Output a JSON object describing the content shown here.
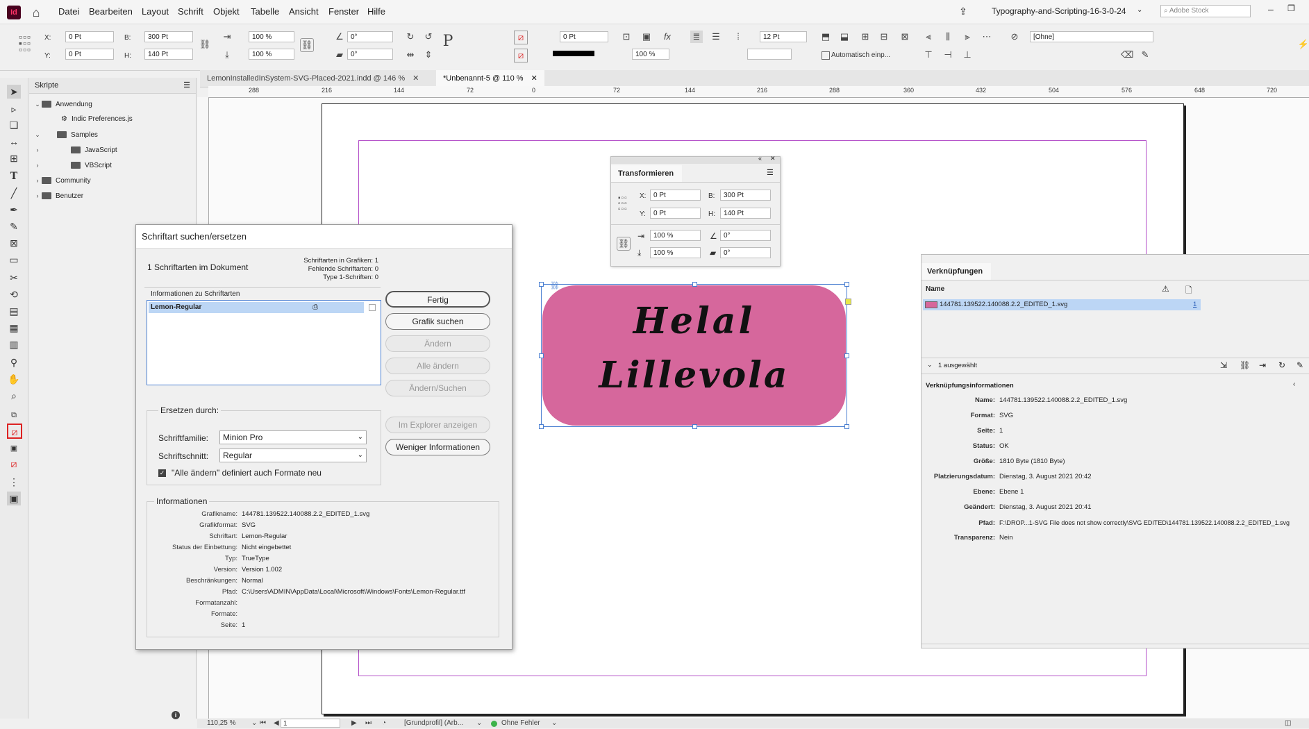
{
  "menubar": {
    "items": [
      "Datei",
      "Bearbeiten",
      "Layout",
      "Schrift",
      "Objekt",
      "Tabelle",
      "Ansicht",
      "Fenster",
      "Hilfe"
    ],
    "workspace": "Typography-and-Scripting-16-3-0-24",
    "stock_placeholder": "Adobe Stock"
  },
  "control": {
    "x": "0 Pt",
    "y": "0 Pt",
    "w": "300 Pt",
    "h": "140 Pt",
    "scale_x": "100 %",
    "scale_y": "100 %",
    "rotate": "0°",
    "shear": "0°",
    "stroke": "0 Pt",
    "opacity": "100 %",
    "spacing": "12 Pt",
    "style": "[Ohne]",
    "autofit": "Automatisch einp..."
  },
  "tabs": [
    {
      "label": "LemonInstalledInSystem-SVG-Placed-2021.indd @ 146 %"
    },
    {
      "label": "*Unbenannt-5 @ 110 %"
    }
  ],
  "ruler_ticks": [
    "288",
    "216",
    "144",
    "72",
    "0",
    "72",
    "144",
    "216",
    "288",
    "360",
    "432",
    "504",
    "576",
    "648",
    "720"
  ],
  "scripts_panel": {
    "title": "Skripte",
    "items": [
      {
        "label": "Anwendung"
      },
      {
        "label": "Indic Preferences.js"
      },
      {
        "label": "Samples"
      },
      {
        "label": "JavaScript"
      },
      {
        "label": "VBScript"
      },
      {
        "label": "Community"
      },
      {
        "label": "Benutzer"
      }
    ]
  },
  "find_font_dialog": {
    "title": "Schriftart suchen/ersetzen",
    "fonts_count": "1 Schriftarten im Dokument",
    "stats": [
      "Schriftarten in Grafiken: 1",
      "Fehlende Schriftarten: 0",
      "Type 1-Schriften: 0"
    ],
    "list_header": "Informationen zu Schriftarten",
    "font_row": "Lemon-Regular",
    "buttons": [
      "Fertig",
      "Grafik suchen",
      "Ändern",
      "Alle ändern",
      "Ändern/Suchen",
      "Im Explorer anzeigen",
      "Weniger Informationen"
    ],
    "replace_legend": "Ersetzen durch:",
    "family_label": "Schriftfamilie:",
    "family_value": "Minion Pro",
    "style_label": "Schriftschnitt:",
    "style_value": "Regular",
    "redefine_label": "\"Alle ändern\" definiert auch Formate neu",
    "info_legend": "Informationen",
    "info": [
      {
        "k": "Grafikname:",
        "v": "144781.139522.140088.2.2_EDITED_1.svg"
      },
      {
        "k": "Grafikformat:",
        "v": "SVG"
      },
      {
        "k": "Schriftart:",
        "v": "Lemon-Regular"
      },
      {
        "k": "Status der Einbettung:",
        "v": "Nicht eingebettet"
      },
      {
        "k": "Typ:",
        "v": "TrueType"
      },
      {
        "k": "Version:",
        "v": "Version 1.002"
      },
      {
        "k": "Beschränkungen:",
        "v": "Normal"
      },
      {
        "k": "Pfad:",
        "v": "C:\\Users\\ADMIN\\AppData\\Local\\Microsoft\\Windows\\Fonts\\Lemon-Regular.ttf"
      },
      {
        "k": "Formatanzahl:",
        "v": ""
      },
      {
        "k": "Formate:",
        "v": ""
      },
      {
        "k": "Seite:",
        "v": "1"
      }
    ]
  },
  "transform_panel": {
    "title": "Transformieren",
    "x": "0 Pt",
    "y": "0 Pt",
    "b": "300 Pt",
    "h": "140 Pt",
    "scale_x": "100 %",
    "scale_y": "100 %",
    "rot": "0°",
    "shear": "0°"
  },
  "artwork": {
    "line1": "Helal",
    "line2": "Lillevola",
    "color": "#d6679c"
  },
  "links_panel": {
    "title": "Verknüpfungen",
    "col_name": "Name",
    "file": "144781.139522.140088.2.2_EDITED_1.svg",
    "page": "1",
    "selected": "1 ausgewählt",
    "info_title": "Verknüpfungsinformationen",
    "info": [
      {
        "k": "Name:",
        "v": "144781.139522.140088.2.2_EDITED_1.svg"
      },
      {
        "k": "Format:",
        "v": "SVG"
      },
      {
        "k": "Seite:",
        "v": "1"
      },
      {
        "k": "Status:",
        "v": "OK"
      },
      {
        "k": "Größe:",
        "v": "1810 Byte (1810 Byte)"
      },
      {
        "k": "Platzierungsdatum:",
        "v": "Dienstag, 3. August 2021 20:42"
      },
      {
        "k": "Ebene:",
        "v": "Ebene 1"
      },
      {
        "k": "Geändert:",
        "v": "Dienstag, 3. August 2021 20:41"
      },
      {
        "k": "Pfad:",
        "v": "F:\\DROP...1-SVG File does not show correctly\\SVG EDITED\\144781.139522.140088.2.2_EDITED_1.svg"
      },
      {
        "k": "Transparenz:",
        "v": "Nein"
      }
    ]
  },
  "status": {
    "zoom": "110,25 %",
    "page": "1",
    "profile": "[Grundprofil] (Arb...",
    "errors": "Ohne Fehler"
  },
  "colors": {
    "accent": "#4a7fd1",
    "selection": "#bcd6f5",
    "artwork": "#d6679c"
  }
}
